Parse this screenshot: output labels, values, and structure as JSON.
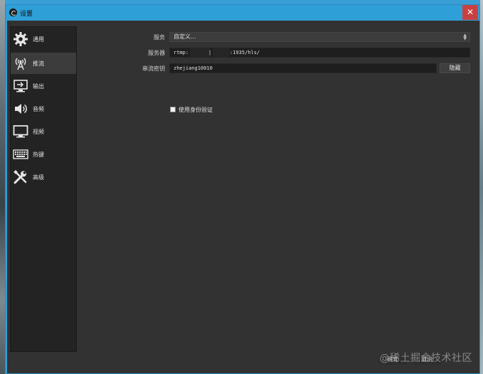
{
  "window": {
    "title": "设置",
    "close_glyph": "✕"
  },
  "sidebar": {
    "items": [
      {
        "label": "通用",
        "icon": "gear-icon",
        "active": false
      },
      {
        "label": "推流",
        "icon": "broadcast-antenna-icon",
        "active": true
      },
      {
        "label": "输出",
        "icon": "output-monitor-icon",
        "active": false
      },
      {
        "label": "音频",
        "icon": "speaker-icon",
        "active": false
      },
      {
        "label": "视频",
        "icon": "display-icon",
        "active": false
      },
      {
        "label": "热键",
        "icon": "keyboard-icon",
        "active": false
      },
      {
        "label": "高级",
        "icon": "tools-icon",
        "active": false
      }
    ]
  },
  "stream": {
    "service_label": "服务",
    "service_value": "自定义...",
    "server_label": "服务器",
    "server_value_prefix": "rtmp:",
    "server_value_mid": "|",
    "server_value_suffix": ":1935/hls/",
    "key_label": "串流密钥",
    "key_value": "zhejiang10010",
    "hide_button": "隐藏",
    "auth_checkbox_label": "使用身份验证",
    "auth_checked": false
  },
  "footer": {
    "ok_button": "确定",
    "cancel_button": "取消",
    "watermark": "@稀土掘金技术社区"
  },
  "colors": {
    "titlebar": "#2f9fd8",
    "client_bg": "#323232",
    "sidebar_bg": "#232323",
    "close_red": "#c84141"
  }
}
